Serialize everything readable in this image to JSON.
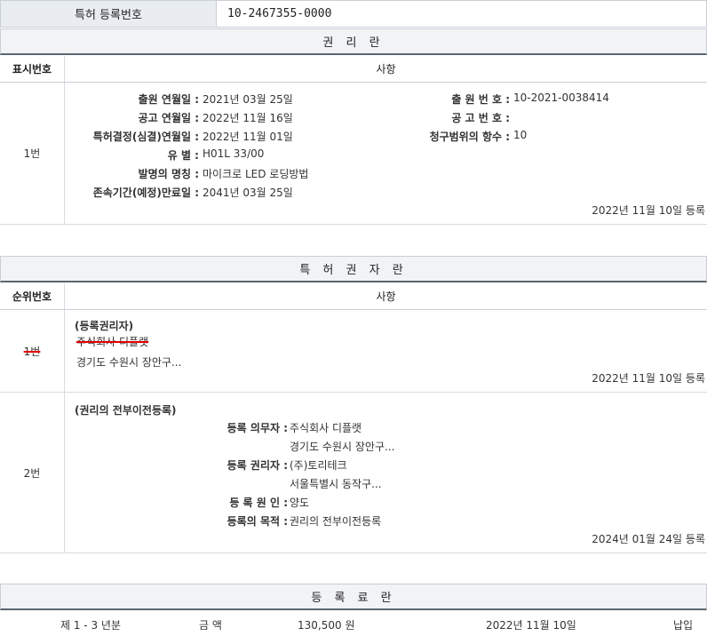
{
  "registration": {
    "label": "특허 등록번호",
    "number": "10-2467355-0000"
  },
  "rights": {
    "title": "권 리 란",
    "col_num": "표시번호",
    "col_matter": "사항",
    "row": {
      "num": "1번",
      "left_keys": [
        "출원 연월일 :",
        "공고 연월일 :",
        "특허결정(심결)연월일 :",
        "유 별 :",
        "발명의 명칭 :",
        "존속기간(예정)만료일 :"
      ],
      "left_values": [
        "2021년 03월 25일",
        "2022년 11월 16일",
        "2022년 11월 01일",
        "H01L 33/00",
        "마이크로 LED 로딩방법",
        "2041년 03월 25일"
      ],
      "right_keys": [
        "출 원 번 호 :",
        "공 고 번 호 :",
        "청구범위의 항수 :"
      ],
      "right_values": [
        "10-2021-0038414",
        "",
        "10"
      ],
      "reg_date": "2022년 11월 10일 등록"
    }
  },
  "patentee": {
    "title": "특 허 권 자 란",
    "col_num": "순위번호",
    "col_matter": "사항",
    "row1": {
      "num": "1번",
      "heading": "(등록권리자)",
      "name": "주식회사 디플랫",
      "address": "경기도 수원시 장안구...",
      "reg_date": "2022년 11월 10일 등록"
    },
    "row2": {
      "num": "2번",
      "heading": "(권리의 전부이전등록)",
      "keys": [
        "등록 의무자 :",
        "등록 권리자 :",
        "등 록 원 인 :",
        "등록의 목적 :"
      ],
      "obligor_name": "주식회사 디플랫",
      "obligor_addr": "경기도 수원시 장안구...",
      "holder_name": "(주)토리테크",
      "holder_addr": "서울특별시 동작구...",
      "cause": "양도",
      "purpose": "권리의 전부이전등록",
      "reg_date": "2024년 01월 24일 등록"
    }
  },
  "fees": {
    "title": "등 록 료 란",
    "row": {
      "period": "제 1 - 3 년분",
      "amount_label": "금 액",
      "amount": "130,500 원",
      "date": "2022년 11월 10일",
      "status": "납입"
    }
  }
}
